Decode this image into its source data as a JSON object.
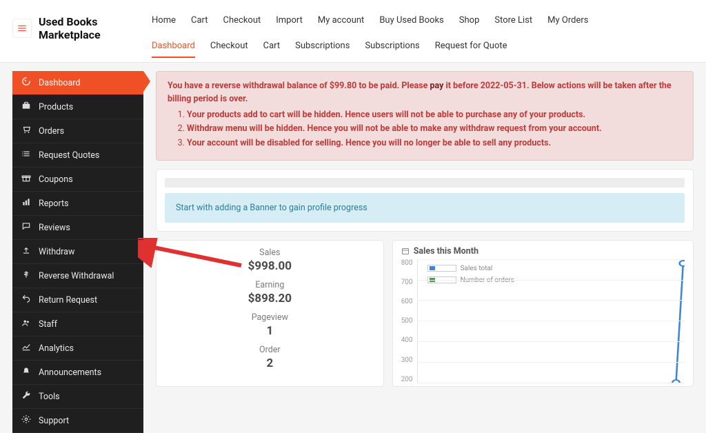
{
  "brand": "Used Books Marketplace",
  "top_nav": {
    "row1": [
      "Home",
      "Cart",
      "Checkout",
      "Import",
      "My account",
      "Buy Used Books",
      "Shop",
      "Store List",
      "My Orders"
    ],
    "row2": [
      "Dashboard",
      "Checkout",
      "Cart",
      "Subscriptions",
      "Subscriptions",
      "Request for Quote"
    ],
    "active_row2_index": 0
  },
  "sidebar": {
    "items": [
      {
        "label": "Dashboard",
        "icon": "dashboard"
      },
      {
        "label": "Products",
        "icon": "briefcase"
      },
      {
        "label": "Orders",
        "icon": "cart"
      },
      {
        "label": "Request Quotes",
        "icon": "list"
      },
      {
        "label": "Coupons",
        "icon": "gift"
      },
      {
        "label": "Reports",
        "icon": "chart"
      },
      {
        "label": "Reviews",
        "icon": "chat"
      },
      {
        "label": "Withdraw",
        "icon": "upload"
      },
      {
        "label": "Reverse Withdrawal",
        "icon": "dollar"
      },
      {
        "label": "Return Request",
        "icon": "undo"
      },
      {
        "label": "Staff",
        "icon": "users"
      },
      {
        "label": "Analytics",
        "icon": "line-chart"
      },
      {
        "label": "Announcements",
        "icon": "bell"
      },
      {
        "label": "Tools",
        "icon": "wrench"
      },
      {
        "label": "Support",
        "icon": "gear"
      }
    ],
    "active_index": 0
  },
  "alert": {
    "prefix": "You have a reverse withdrawal balance of ",
    "amount": "$99.80",
    "mid1": " to be paid. Please ",
    "pay": "pay",
    "mid2": " it before ",
    "deadline": "2022-05-31",
    "suffix": ". Below actions will be taken after the billing period is over.",
    "items": [
      "Your products add to cart will be hidden. Hence users will not be able to purchase any of your products.",
      "Withdraw menu will be hidden. Hence you will not be able to make any withdraw request from your account.",
      "Your account will be disabled for selling. Hence you will no longer be able to sell any products."
    ]
  },
  "banner_note": "Start with adding a Banner to gain profile progress",
  "stats": {
    "sales_label": "Sales",
    "sales_value": "$998.00",
    "earning_label": "Earning",
    "earning_value": "$898.20",
    "pageview_label": "Pageview",
    "pageview_value": "1",
    "order_label": "Order",
    "order_value": "2"
  },
  "chart": {
    "title": "Sales this Month",
    "legend_sales": "Sales total",
    "legend_orders": "Number of orders",
    "y_ticks": [
      "800",
      "700",
      "600",
      "500",
      "400",
      "300",
      "200"
    ]
  },
  "chart_data": {
    "type": "line",
    "title": "Sales this Month",
    "ylabel": "",
    "ylim": [
      200,
      800
    ],
    "series": [
      {
        "name": "Sales total",
        "color": "#3d86d8",
        "values": [
          200,
          800
        ]
      },
      {
        "name": "Number of orders",
        "color": "#3aa54a",
        "values": []
      }
    ],
    "legend_position": "top-left",
    "grid": true
  }
}
